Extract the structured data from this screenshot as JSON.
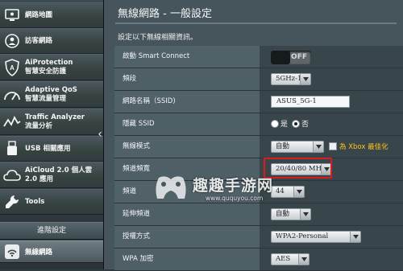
{
  "sidebar": {
    "items": [
      {
        "icon": "network-map-icon",
        "label": "網路地圖",
        "sub": ""
      },
      {
        "icon": "guest-network-icon",
        "label": "訪客網路",
        "sub": ""
      },
      {
        "icon": "aiprotection-icon",
        "label": "AiProtection",
        "sub": "智慧安全防護"
      },
      {
        "icon": "adaptive-qos-icon",
        "label": "Adaptive QoS",
        "sub": "智慧流量管理"
      },
      {
        "icon": "traffic-analyzer-icon",
        "label": "Traffic Analyzer",
        "sub": "流量分析"
      },
      {
        "icon": "usb-icon",
        "label": "USB 相關應用",
        "sub": ""
      },
      {
        "icon": "aicloud-icon",
        "label": "AiCloud 2.0 個人雲",
        "sub": "2.0 應用"
      },
      {
        "icon": "tools-icon",
        "label": "Tools",
        "sub": ""
      }
    ],
    "section": "進階設定",
    "active": {
      "icon": "wireless-icon",
      "label": "無線網路"
    }
  },
  "main": {
    "title": "無線網路 - 一般設定",
    "description": "設定以下無線相關資訊。",
    "rows": {
      "smart_connect": {
        "label": "啟動 Smart Connect",
        "state": "OFF"
      },
      "band": {
        "label": "頻段",
        "value": "5GHz-1"
      },
      "ssid": {
        "label": "網路名稱（SSID)",
        "value": "ASUS_5G-1"
      },
      "hide_ssid": {
        "label": "隱藏 SSID",
        "yes": "是",
        "no": "否"
      },
      "wireless_mode": {
        "label": "無線模式",
        "value": "自動",
        "xbox": "為 Xbox 最佳化"
      },
      "bandwidth": {
        "label": "頻道頻寬",
        "value": "20/40/80 MHz"
      },
      "channel": {
        "label": "頻道",
        "value": "44"
      },
      "ext_channel": {
        "label": "延伸頻道",
        "value": "自動"
      },
      "auth": {
        "label": "授權方式",
        "value": "WPA2-Personal"
      },
      "wpa_enc": {
        "label": "WPA 加密",
        "value": "AES"
      }
    }
  },
  "watermark": {
    "text": "趣趣手游网",
    "url": "www.ququyou.com"
  },
  "colors": {
    "highlight": "#d81d1d",
    "xbox_label": "#ffc41f"
  }
}
